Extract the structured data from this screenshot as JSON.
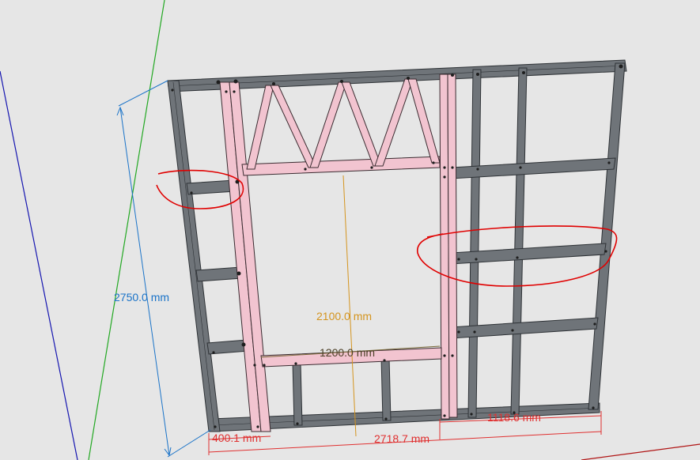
{
  "colors": {
    "background": "#e6e6e6",
    "steel": "#6f7479",
    "steel_dark": "#2e3236",
    "highlight_fill": "#f2c4d0",
    "highlight_stroke": "#3a2b30",
    "axis_green": "#22a822",
    "axis_blue": "#1515b0",
    "dim_blue": "#1a73c8",
    "dim_red": "#e03030",
    "dim_orange": "#d4941e",
    "dim_brown": "#7a6a3a",
    "markup_red": "#e00000"
  },
  "dimensions": {
    "total_height": "2750.0 mm",
    "opening_height": "2100.0 mm",
    "opening_width": "1200.0 mm",
    "total_width": "2718.7 mm",
    "right_bay_width": "1118.6 mm",
    "left_bay_width": "400.1 mm"
  },
  "annotations": {
    "left_circle": "red-freehand-ellipse-left-noggin",
    "right_circle": "red-freehand-ellipse-right-noggins"
  }
}
